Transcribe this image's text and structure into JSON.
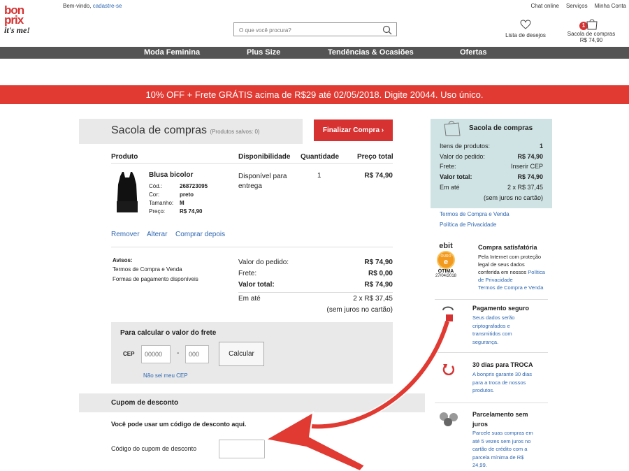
{
  "header": {
    "logo_top": "bon",
    "logo_mid": "prix",
    "logo_tag": "it's me!",
    "welcome": "Bem-vindo,",
    "signup": "cadastre-se",
    "top_links": [
      "Chat online",
      "Serviços",
      "Minha Conta"
    ],
    "search_placeholder": "O que você procura?",
    "wishlist": "Lista de desejos",
    "bag_label": "Sacola de compras",
    "bag_price": "R$ 74,90",
    "bag_count": "1"
  },
  "nav": [
    "Moda Feminina",
    "Plus Size",
    "Tendências & Ocasiões",
    "Ofertas"
  ],
  "promo": "10% OFF + Frete GRÁTIS acima de R$29 até 02/05/2018. Digite 20044. Uso único.",
  "cart": {
    "title": "Sacola de compras",
    "saved": "(Produtos salvos: 0)",
    "checkout": "Finalizar Compra",
    "cols": [
      "Produto",
      "Disponibilidade",
      "Quantidade",
      "Preço total"
    ],
    "item": {
      "name": "Blusa bicolor",
      "cod_l": "Cód.:",
      "cod": "268723095",
      "cor_l": "Cor:",
      "cor": "preto",
      "tam_l": "Tamanho:",
      "tam": "M",
      "preco_l": "Preço:",
      "preco": "R$ 74,90",
      "avail": "Disponível para entrega",
      "qty": "1",
      "total": "R$ 74,90"
    },
    "actions": [
      "Remover",
      "Alterar",
      "Comprar depois"
    ],
    "notices_title": "Avisos:",
    "notices": [
      "Termos de Compra e Venda",
      "Formas de pagamento disponíveis"
    ],
    "sum": {
      "order_l": "Valor do pedido:",
      "order": "R$ 74,90",
      "ship_l": "Frete:",
      "ship": "R$ 0,00",
      "total_l": "Valor total:",
      "total": "R$ 74,90",
      "inst_l": "Em até",
      "inst": "2 x R$ 37,45",
      "inst_note": "(sem juros no cartão)"
    },
    "shipping": {
      "title": "Para calcular o valor do frete",
      "cep_l": "CEP",
      "cep1": "00000",
      "dash": "-",
      "cep2": "000",
      "btn": "Calcular",
      "help": "Não sei meu CEP"
    },
    "coupon": {
      "title": "Cupom de desconto",
      "hint": "Você pode usar um código de desconto aqui.",
      "label": "Código do cupom de desconto"
    }
  },
  "sidebar": {
    "title": "Sacola de compras",
    "rows": [
      [
        "Itens de produtos:",
        "1"
      ],
      [
        "Valor do pedido:",
        "R$ 74,90"
      ],
      [
        "Frete:",
        "Inserir CEP"
      ],
      [
        "Valor total:",
        "R$ 74,90"
      ],
      [
        "Em até",
        "2 x R$ 37,45"
      ]
    ],
    "inst_note": "(sem juros no cartão)",
    "links": [
      "Termos de Compra e Venda",
      "Política de Privacidade"
    ],
    "ebit": {
      "title": "Compra satisfatória",
      "l1": "Pela Internet com proteção",
      "l2": "legal de seus dados",
      "l3": "conferida em nossos",
      "l3b": "Política",
      "l4": "de Privacidade",
      "l5": "Termos de Compra e Venda",
      "badge_top": "ebit",
      "badge_mid": "OURO",
      "badge_rate": "ÓTIMA",
      "badge_date": "27/04/2018"
    },
    "secure": {
      "title": "Pagamento seguro",
      "l1": "Seus dados serão",
      "l2": "criptografados e",
      "l3": "transmitidos com",
      "l4": "segurança."
    },
    "returns": {
      "title": "30 dias para TROCA",
      "l1": "A bonprix garante 30 dias",
      "l2": "para a troca de nossos",
      "l3": "produtos."
    },
    "install": {
      "title1": "Parcelamento sem",
      "title2": "juros",
      "l1": "Parcele suas compras em",
      "l2": "até 5 vezes sem juros no",
      "l3": "cartão de crédito com a",
      "l4": "parcela mínima de R$",
      "l5": "24,99."
    }
  },
  "colors": {
    "accent": "#d63231",
    "nav": "#545454",
    "sidebar": "#cfe3e4",
    "link": "#2e67b1"
  }
}
